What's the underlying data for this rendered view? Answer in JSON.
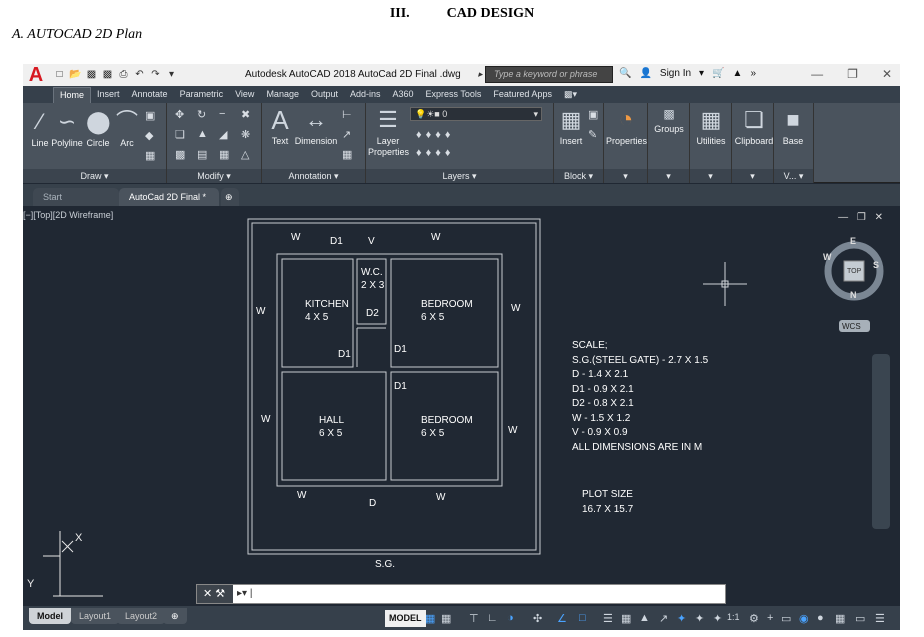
{
  "doc": {
    "section_num": "III.",
    "section_title": "CAD DESIGN",
    "subtitle": "A.   AUTOCAD 2D Plan"
  },
  "app": {
    "logo": "A",
    "title": "Autodesk AutoCAD 2018   AutoCad 2D Final .dwg",
    "search_placeholder": "Type a keyword or phrase",
    "sign_in": "Sign In",
    "ribbon_tabs": [
      "Home",
      "Insert",
      "Annotate",
      "Parametric",
      "View",
      "Manage",
      "Output",
      "Add-ins",
      "A360",
      "Express Tools",
      "Featured Apps"
    ],
    "draw": {
      "line": "Line",
      "polyline": "Polyline",
      "circle": "Circle",
      "arc": "Arc",
      "title": "Draw"
    },
    "modify": {
      "title": "Modify"
    },
    "annotation": {
      "text": "Text",
      "dimension": "Dimension",
      "title": "Annotation"
    },
    "layers": {
      "layer_props": "Layer Properties",
      "combo": "0",
      "title": "Layers"
    },
    "block": {
      "insert": "Insert",
      "title": "Block"
    },
    "tools": {
      "properties": "Properties",
      "groups": "Groups",
      "utilities": "Utilities",
      "clipboard": "Clipboard",
      "base": "Base",
      "view": "V..."
    },
    "doc_tabs": {
      "start": "Start",
      "active": "AutoCad 2D Final *"
    },
    "viewport_label": "[−][Top][2D Wireframe]",
    "viewcube": {
      "n": "N",
      "s": "S",
      "e": "E",
      "w": "W",
      "top": "TOP",
      "wcs": "WCS"
    },
    "layout_tabs": [
      "Model",
      "Layout1",
      "Layout2"
    ],
    "status_model": "MODEL",
    "scale": "1:1"
  },
  "plan": {
    "rooms": [
      {
        "name": "KITCHEN",
        "size": "4 X 5"
      },
      {
        "name": "W.C.",
        "size": "2 X 3"
      },
      {
        "name": "BEDROOM",
        "size": "6 X 5"
      },
      {
        "name": "HALL",
        "size": "6 X 5"
      },
      {
        "name": "BEDROOM",
        "size": "6 X 5"
      }
    ],
    "tags": {
      "w": "W",
      "d": "D",
      "d1": "D1",
      "d2": "D2",
      "v": "V",
      "sg": "S.G."
    },
    "notes": [
      "SCALE;",
      "S.G.(STEEL GATE) - 2.7 X 1.5",
      "D - 1.4 X 2.1",
      "D1 - 0.9 X 2.1",
      "D2 - 0.8 X 2.1",
      "W - 1.5 X 1.2",
      "V - 0.9 X 0.9",
      "ALL DIMENSIONS ARE IN M"
    ],
    "plot": [
      "PLOT SIZE",
      "16.7 X 15.7"
    ],
    "axes": {
      "x": "X",
      "y": "Y"
    }
  }
}
